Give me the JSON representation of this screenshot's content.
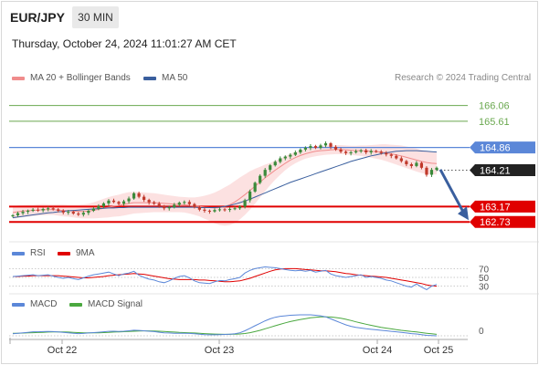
{
  "header": {
    "symbol": "EUR/JPY",
    "timeframe": "30 MIN",
    "timestamp": "Thursday, October 24, 2024 11:01:27 AM CET"
  },
  "legend": {
    "ma20": "MA 20 + Bollinger Bands",
    "ma50": "MA 50",
    "credit": "Research © 2024 Trading Central",
    "rsi": "RSI",
    "rsi_ma": "9MA",
    "macd": "MACD",
    "macd_signal": "MACD Signal"
  },
  "colors": {
    "ma20": "#f08c8c",
    "ma50": "#3a5f9e",
    "bollinger_fill": "#fbdcdc",
    "candle_up": "#3a8a3a",
    "candle_down": "#c0392b",
    "resistance": "#6aa84f",
    "current_level": "#5b87d8",
    "support": "#e00000",
    "price_tag": "#222222",
    "arrow": "#3a5f9e",
    "rsi": "#5b87d8",
    "rsi_ma": "#e00000",
    "macd": "#5b87d8",
    "macd_signal": "#4aa83f"
  },
  "chart_data": [
    {
      "type": "candlestick",
      "title": "EUR/JPY 30 MIN",
      "ylim": [
        162.5,
        166.6
      ],
      "x_ticks": [
        "Oct 22",
        "Oct 23",
        "Oct 24",
        "Oct 25"
      ],
      "levels": [
        {
          "value": 166.06,
          "label": "166.06",
          "kind": "resistance"
        },
        {
          "value": 165.61,
          "label": "165.61",
          "kind": "resistance"
        },
        {
          "value": 164.86,
          "label": "164.86",
          "kind": "pivot"
        },
        {
          "value": 164.21,
          "label": "164.21",
          "kind": "last"
        },
        {
          "value": 163.17,
          "label": "163.17",
          "kind": "support"
        },
        {
          "value": 162.73,
          "label": "162.73",
          "kind": "support"
        }
      ],
      "close": [
        162.92,
        162.98,
        163.02,
        163.05,
        163.08,
        163.06,
        163.1,
        163.12,
        163.09,
        163.05,
        163.0,
        163.02,
        162.97,
        162.94,
        162.99,
        163.05,
        163.11,
        163.18,
        163.26,
        163.34,
        163.3,
        163.25,
        163.32,
        163.4,
        163.55,
        163.45,
        163.36,
        163.29,
        163.25,
        163.18,
        163.12,
        163.15,
        163.22,
        163.28,
        163.3,
        163.24,
        163.15,
        163.08,
        163.05,
        163.03,
        163.07,
        163.09,
        163.08,
        163.1,
        163.12,
        163.17,
        163.35,
        163.6,
        163.85,
        164.05,
        164.22,
        164.35,
        164.45,
        164.55,
        164.6,
        164.65,
        164.72,
        164.8,
        164.85,
        164.9,
        164.85,
        164.92,
        164.98,
        164.88,
        164.8,
        164.74,
        164.7,
        164.72,
        164.75,
        164.78,
        164.72,
        164.76,
        164.74,
        164.7,
        164.66,
        164.62,
        164.55,
        164.47,
        164.38,
        164.33,
        164.42,
        164.28,
        164.08,
        164.22,
        164.28
      ],
      "ma20": [
        163.0,
        163.02,
        163.04,
        163.05,
        163.06,
        163.07,
        163.08,
        163.08,
        163.08,
        163.07,
        163.06,
        163.05,
        163.04,
        163.03,
        163.03,
        163.04,
        163.06,
        163.09,
        163.12,
        163.15,
        163.18,
        163.2,
        163.23,
        163.26,
        163.28,
        163.28,
        163.28,
        163.28,
        163.28,
        163.27,
        163.26,
        163.25,
        163.24,
        163.23,
        163.22,
        163.2,
        163.18,
        163.17,
        163.15,
        163.14,
        163.13,
        163.14,
        163.17,
        163.22,
        163.3,
        163.4,
        163.51,
        163.63,
        163.75,
        163.87,
        163.99,
        164.1,
        164.21,
        164.31,
        164.41,
        164.5,
        164.57,
        164.63,
        164.68,
        164.72,
        164.75,
        164.77,
        164.78,
        164.79,
        164.8,
        164.8,
        164.79,
        164.78,
        164.77,
        164.77,
        164.76,
        164.75,
        164.74,
        164.73,
        164.71,
        164.68,
        164.65,
        164.62,
        164.58,
        164.54,
        164.5,
        164.46,
        164.43,
        164.41,
        164.4
      ],
      "ma50": [
        162.85,
        162.87,
        162.89,
        162.91,
        162.93,
        162.95,
        162.97,
        162.99,
        163.0,
        163.02,
        163.03,
        163.05,
        163.06,
        163.07,
        163.08,
        163.09,
        163.1,
        163.11,
        163.12,
        163.13,
        163.13,
        163.14,
        163.14,
        163.15,
        163.15,
        163.15,
        163.15,
        163.15,
        163.15,
        163.15,
        163.15,
        163.15,
        163.15,
        163.15,
        163.15,
        163.15,
        163.15,
        163.14,
        163.14,
        163.14,
        163.14,
        163.15,
        163.17,
        163.2,
        163.24,
        163.28,
        163.33,
        163.38,
        163.44,
        163.5,
        163.56,
        163.62,
        163.68,
        163.74,
        163.8,
        163.86,
        163.91,
        163.96,
        164.01,
        164.06,
        164.11,
        164.16,
        164.21,
        164.26,
        164.31,
        164.36,
        164.41,
        164.46,
        164.5,
        164.54,
        164.58,
        164.62,
        164.65,
        164.68,
        164.71,
        164.73,
        164.75,
        164.76,
        164.77,
        164.77,
        164.77,
        164.76,
        164.75,
        164.74,
        164.73
      ],
      "bollinger_width": [
        0.18,
        0.18,
        0.17,
        0.17,
        0.16,
        0.16,
        0.16,
        0.15,
        0.15,
        0.16,
        0.17,
        0.17,
        0.18,
        0.19,
        0.2,
        0.21,
        0.23,
        0.25,
        0.27,
        0.29,
        0.3,
        0.31,
        0.32,
        0.32,
        0.31,
        0.3,
        0.29,
        0.28,
        0.27,
        0.26,
        0.25,
        0.24,
        0.23,
        0.22,
        0.22,
        0.23,
        0.25,
        0.28,
        0.33,
        0.38,
        0.44,
        0.5,
        0.55,
        0.58,
        0.6,
        0.6,
        0.58,
        0.55,
        0.5,
        0.44,
        0.38,
        0.32,
        0.27,
        0.23,
        0.2,
        0.18,
        0.16,
        0.15,
        0.14,
        0.14,
        0.14,
        0.14,
        0.13,
        0.13,
        0.13,
        0.13,
        0.13,
        0.13,
        0.14,
        0.15,
        0.16,
        0.18,
        0.2,
        0.22,
        0.24,
        0.26,
        0.28,
        0.3,
        0.31,
        0.32,
        0.33,
        0.33,
        0.33,
        0.32,
        0.31
      ]
    },
    {
      "type": "line",
      "title": "RSI",
      "ylim": [
        0,
        100
      ],
      "y_ticks": [
        "70",
        "50",
        "30"
      ],
      "series": [
        {
          "name": "RSI",
          "values": [
            52,
            53,
            54,
            55,
            56,
            54,
            55,
            56,
            53,
            50,
            48,
            50,
            47,
            45,
            49,
            53,
            56,
            58,
            60,
            62,
            58,
            54,
            58,
            60,
            64,
            55,
            50,
            46,
            44,
            40,
            38,
            42,
            48,
            52,
            54,
            49,
            42,
            38,
            37,
            36,
            40,
            43,
            42,
            45,
            47,
            50,
            60,
            66,
            70,
            72,
            74,
            73,
            72,
            70,
            68,
            66,
            65,
            66,
            64,
            66,
            62,
            64,
            66,
            58,
            54,
            52,
            50,
            52,
            54,
            56,
            50,
            52,
            50,
            48,
            44,
            42,
            38,
            34,
            30,
            28,
            35,
            28,
            22,
            30,
            34
          ]
        },
        {
          "name": "9MA",
          "values": [
            52,
            52,
            53,
            53,
            54,
            54,
            54,
            54,
            54,
            54,
            53,
            52,
            51,
            50,
            49,
            49,
            50,
            51,
            52,
            54,
            55,
            56,
            57,
            58,
            59,
            58,
            57,
            55,
            53,
            51,
            49,
            47,
            46,
            45,
            45,
            45,
            45,
            44,
            44,
            43,
            42,
            41,
            40,
            40,
            41,
            42,
            45,
            48,
            52,
            56,
            60,
            64,
            67,
            69,
            70,
            70,
            70,
            69,
            68,
            67,
            66,
            65,
            65,
            64,
            63,
            61,
            59,
            58,
            56,
            55,
            54,
            53,
            52,
            51,
            50,
            48,
            46,
            44,
            42,
            40,
            38,
            36,
            33,
            31,
            30
          ]
        }
      ]
    },
    {
      "type": "line",
      "title": "MACD",
      "y_ticks": [
        "0"
      ],
      "series": [
        {
          "name": "MACD",
          "values": [
            0.02,
            0.025,
            0.03,
            0.035,
            0.04,
            0.04,
            0.042,
            0.044,
            0.042,
            0.038,
            0.034,
            0.03,
            0.026,
            0.022,
            0.024,
            0.028,
            0.032,
            0.036,
            0.04,
            0.045,
            0.046,
            0.044,
            0.046,
            0.05,
            0.056,
            0.054,
            0.05,
            0.046,
            0.042,
            0.036,
            0.03,
            0.028,
            0.026,
            0.026,
            0.026,
            0.024,
            0.02,
            0.016,
            0.012,
            0.01,
            0.01,
            0.012,
            0.014,
            0.016,
            0.02,
            0.03,
            0.05,
            0.075,
            0.1,
            0.125,
            0.15,
            0.17,
            0.185,
            0.195,
            0.2,
            0.205,
            0.208,
            0.21,
            0.21,
            0.21,
            0.205,
            0.2,
            0.19,
            0.17,
            0.15,
            0.13,
            0.11,
            0.095,
            0.085,
            0.078,
            0.07,
            0.065,
            0.06,
            0.055,
            0.05,
            0.045,
            0.04,
            0.035,
            0.028,
            0.022,
            0.018,
            0.012,
            0.005,
            0.002,
            0.0
          ]
        },
        {
          "name": "MACD Signal",
          "values": [
            0.025,
            0.026,
            0.027,
            0.029,
            0.031,
            0.033,
            0.035,
            0.037,
            0.039,
            0.039,
            0.038,
            0.037,
            0.035,
            0.032,
            0.03,
            0.029,
            0.029,
            0.03,
            0.032,
            0.034,
            0.037,
            0.039,
            0.041,
            0.043,
            0.046,
            0.048,
            0.049,
            0.049,
            0.048,
            0.046,
            0.043,
            0.04,
            0.037,
            0.034,
            0.032,
            0.03,
            0.028,
            0.025,
            0.022,
            0.019,
            0.017,
            0.016,
            0.015,
            0.015,
            0.016,
            0.018,
            0.023,
            0.031,
            0.042,
            0.055,
            0.07,
            0.085,
            0.1,
            0.115,
            0.13,
            0.142,
            0.153,
            0.163,
            0.172,
            0.18,
            0.185,
            0.19,
            0.19,
            0.188,
            0.183,
            0.175,
            0.165,
            0.153,
            0.14,
            0.128,
            0.116,
            0.105,
            0.095,
            0.085,
            0.077,
            0.069,
            0.062,
            0.055,
            0.049,
            0.043,
            0.038,
            0.032,
            0.026,
            0.02,
            0.015
          ]
        }
      ]
    }
  ]
}
